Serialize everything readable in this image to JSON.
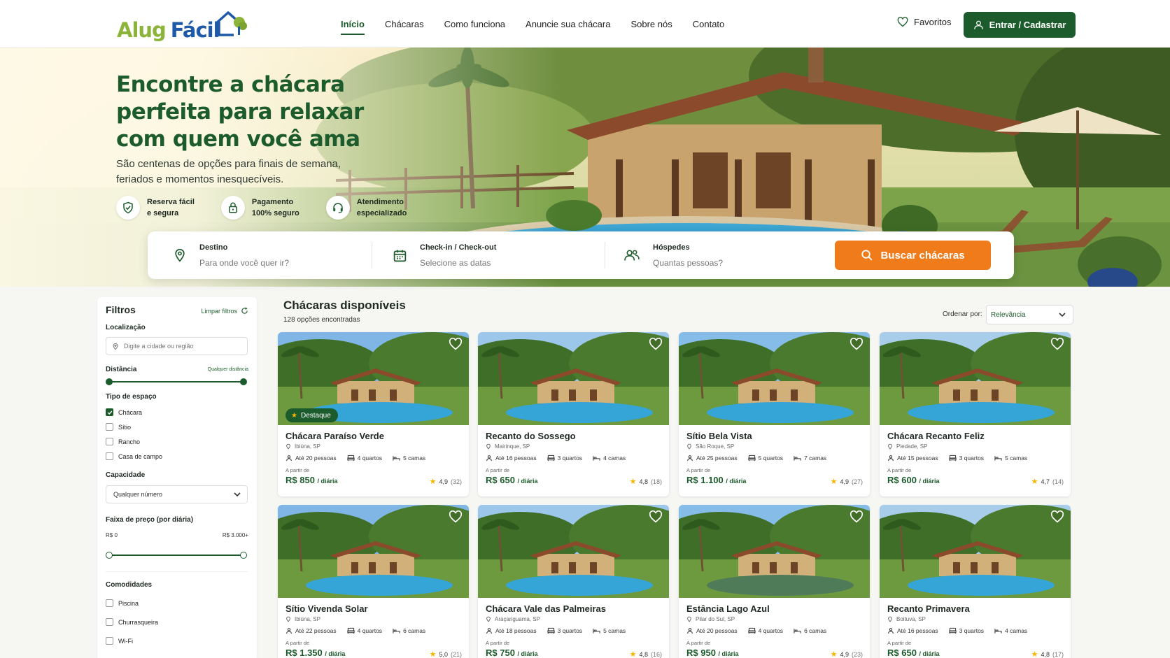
{
  "brand": {
    "name_part1": "Alug",
    "name_part2": "Fácil"
  },
  "nav": {
    "items": [
      "Início",
      "Chácaras",
      "Como funciona",
      "Anuncie sua chácara",
      "Sobre nós",
      "Contato"
    ],
    "active_index": 0,
    "favorites": "Favoritos",
    "login": "Entrar / Cadastrar"
  },
  "hero": {
    "title": "Encontre a chácara perfeita para relaxar com quem você ama",
    "subtitle": "São centenas de opções para finais de semana, feriados e momentos inesquecíveis.",
    "features": [
      {
        "icon": "shield-check-icon",
        "text": "Reserva fácil\ne segura"
      },
      {
        "icon": "lock-icon",
        "text": "Pagamento\n100% seguro"
      },
      {
        "icon": "headset-icon",
        "text": "Atendimento\nespecializado"
      }
    ]
  },
  "search": {
    "destination_label": "Destino",
    "destination_placeholder": "Para onde você quer ir?",
    "dates_label": "Check-in / Check-out",
    "dates_placeholder": "Selecione as datas",
    "guests_label": "Hóspedes",
    "guests_placeholder": "Quantas pessoas?",
    "button": "Buscar chácaras"
  },
  "filters": {
    "title": "Filtros",
    "clear": "Limpar filtros",
    "location_label": "Localização",
    "location_placeholder": "Digite a cidade ou região",
    "distance_label": "Distância",
    "distance_value": "Qualquer distância",
    "type_label": "Tipo de espaço",
    "types": [
      {
        "label": "Chácara",
        "checked": true
      },
      {
        "label": "Sítio",
        "checked": false
      },
      {
        "label": "Rancho",
        "checked": false
      },
      {
        "label": "Casa de campo",
        "checked": false
      }
    ],
    "capacity_label": "Capacidade",
    "capacity_value": "Qualquer número",
    "price_label": "Faixa de preço (por diária)",
    "price_min": "R$ 0",
    "price_max": "R$ 3.000+",
    "amenities_label": "Comodidades",
    "amenities": [
      {
        "label": "Piscina",
        "checked": false
      },
      {
        "label": "Churrasqueira",
        "checked": false
      },
      {
        "label": "Wi-Fi",
        "checked": false
      }
    ]
  },
  "results": {
    "title": "Chácaras disponíveis",
    "count": "128 opções encontradas",
    "sort_label": "Ordenar por:",
    "sort_value": "Relevância",
    "from_label": "A partir de",
    "per_day": "/ diária",
    "featured_badge": "Destaque",
    "listings": [
      {
        "name": "Chácara Paraíso Verde",
        "location": "Ibiúna, SP",
        "people": "Até 20 pessoas",
        "rooms": "4 quartos",
        "beds": "5 camas",
        "price": "R$ 850",
        "rating": "4,9",
        "reviews": "(32)",
        "featured": true
      },
      {
        "name": "Recanto do Sossego",
        "location": "Mairinque, SP",
        "people": "Até 16 pessoas",
        "rooms": "3 quartos",
        "beds": "4 camas",
        "price": "R$ 650",
        "rating": "4,8",
        "reviews": "(18)",
        "featured": false
      },
      {
        "name": "Sítio Bela Vista",
        "location": "São Roque, SP",
        "people": "Até 25 pessoas",
        "rooms": "5 quartos",
        "beds": "7 camas",
        "price": "R$ 1.100",
        "rating": "4,9",
        "reviews": "(27)",
        "featured": false
      },
      {
        "name": "Chácara Recanto Feliz",
        "location": "Piedade, SP",
        "people": "Até 15 pessoas",
        "rooms": "3 quartos",
        "beds": "5 camas",
        "price": "R$ 600",
        "rating": "4,7",
        "reviews": "(14)",
        "featured": false
      },
      {
        "name": "Sítio Vivenda Solar",
        "location": "Ibiúna, SP",
        "people": "Até 22 pessoas",
        "rooms": "4 quartos",
        "beds": "6 camas",
        "price": "R$ 1.350",
        "rating": "5,0",
        "reviews": "(21)",
        "featured": false
      },
      {
        "name": "Chácara Vale das Palmeiras",
        "location": "Araçariguama, SP",
        "people": "Até 18 pessoas",
        "rooms": "3 quartos",
        "beds": "5 camas",
        "price": "R$ 750",
        "rating": "4,8",
        "reviews": "(16)",
        "featured": false
      },
      {
        "name": "Estância Lago Azul",
        "location": "Pilar do Sul, SP",
        "people": "Até 20 pessoas",
        "rooms": "4 quartos",
        "beds": "6 camas",
        "price": "R$ 950",
        "rating": "4,9",
        "reviews": "(23)",
        "featured": false
      },
      {
        "name": "Recanto Primavera",
        "location": "Boituva, SP",
        "people": "Até 16 pessoas",
        "rooms": "3 quartos",
        "beds": "4 camas",
        "price": "R$ 650",
        "rating": "4,8",
        "reviews": "(17)",
        "featured": false
      }
    ]
  },
  "colors": {
    "primary": "#1c5b2b",
    "accent": "#f07b1a",
    "brand_green": "#8db43a",
    "brand_blue": "#1e5aa8"
  }
}
